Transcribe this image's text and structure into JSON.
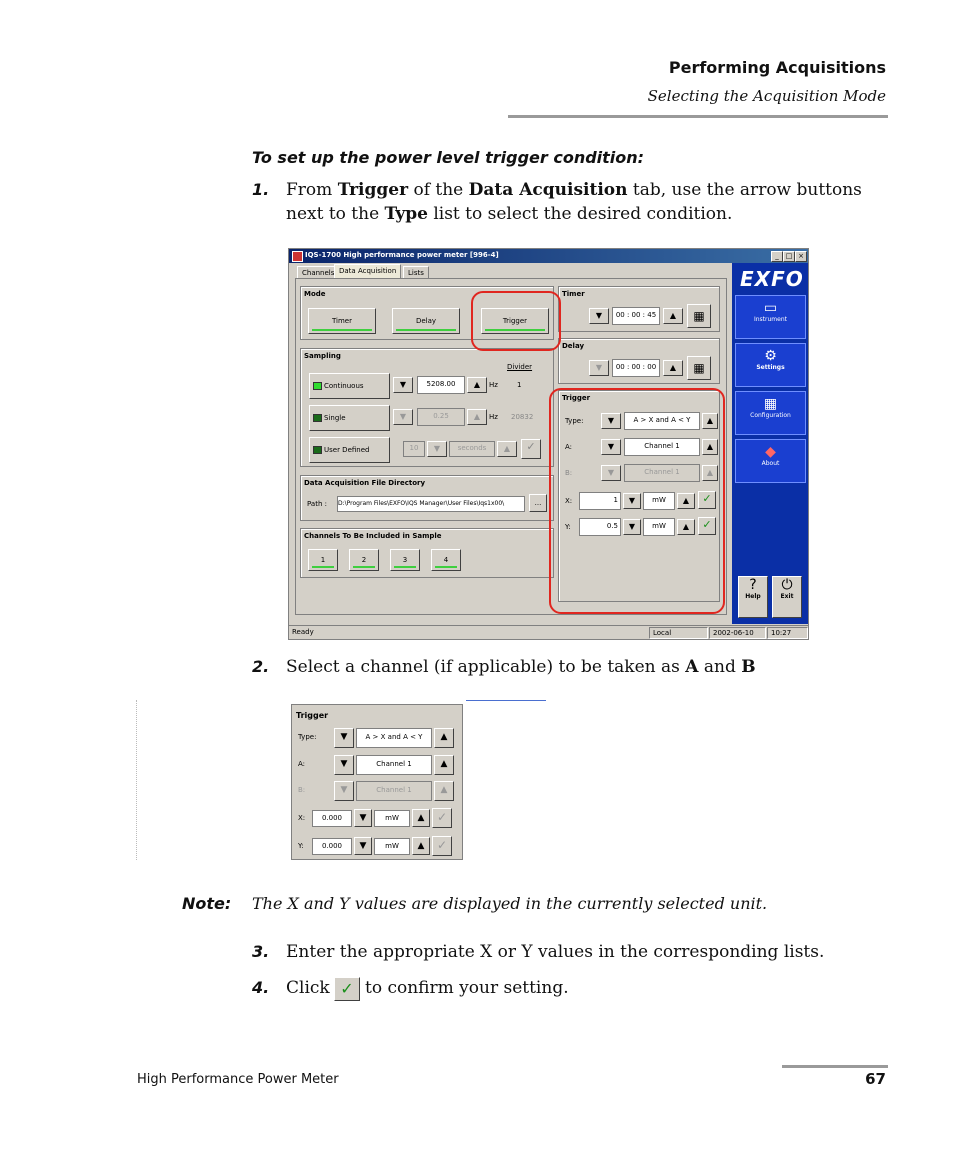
{
  "header": {
    "title": "Performing Acquisitions",
    "subtitle": "Selecting the Acquisition Mode"
  },
  "procedure_title": "To set up the power level trigger condition:",
  "steps": [
    {
      "num": "1.",
      "parts": [
        "From ",
        "Trigger",
        " of the ",
        "Data Acquisition",
        " tab, use the arrow buttons next to the ",
        "Type",
        " list to select the desired condition."
      ]
    },
    {
      "num": "2.",
      "parts": [
        "Select a channel (if applicable) to be taken as ",
        "A",
        " and ",
        "B"
      ]
    },
    {
      "num": "3.",
      "text": "Enter the appropriate X or Y values in the corresponding lists."
    },
    {
      "num": "4.",
      "pre": "Click",
      "post": "to confirm your setting."
    }
  ],
  "note": {
    "label": "Note:",
    "text": "The X and Y values are displayed in the currently selected unit."
  },
  "footer": {
    "left": "High Performance Power Meter",
    "page": "67"
  },
  "app": {
    "title": "IQS-1700 High performance power meter [996-4]",
    "tabs": [
      "Channels",
      "Data Acquisition",
      "Lists"
    ],
    "mode": {
      "title": "Mode",
      "buttons": [
        "Timer",
        "Delay",
        "Trigger"
      ]
    },
    "timer": {
      "title": "Timer",
      "value": "00 : 00 : 45"
    },
    "delay": {
      "title": "Delay",
      "value": "00 : 00 : 00"
    },
    "sampling": {
      "title": "Sampling",
      "divider_label": "Divider",
      "continuous": "Continuous",
      "cont_value": "5208.00",
      "cont_unit": "Hz",
      "cont_div": "1",
      "single": "Single",
      "single_value": "0.25",
      "single_unit": "Hz",
      "single_div": "20832",
      "user_defined": "User Defined",
      "ud_n": "10",
      "ud_unit": "seconds"
    },
    "directory": {
      "title": "Data Acquisition File Directory",
      "path_label": "Path :",
      "path": "D:\\Program Files\\EXFO\\IQS Manager\\User Files\\Iqs1x00\\",
      "browse": "..."
    },
    "channels": {
      "title": "Channels To Be Included in Sample",
      "items": [
        "1",
        "2",
        "3",
        "4"
      ]
    },
    "trigger": {
      "title": "Trigger",
      "type_label": "Type:",
      "type_value": "A > X and A < Y",
      "a_label": "A:",
      "a_value": "Channel 1",
      "b_label": "B:",
      "b_value": "Channel 1",
      "x_label": "X:",
      "x_value": "1",
      "x_unit": "mW",
      "y_label": "Y:",
      "y_value": "0.5",
      "y_unit": "mW"
    },
    "sidebar": {
      "logo": "EXFO",
      "items": [
        "Instrument",
        "Settings",
        "Configuration",
        "About"
      ],
      "help": "Help",
      "exit": "Exit"
    },
    "status": {
      "ready": "Ready",
      "local": "Local",
      "date": "2002-06-10",
      "time": "10:27"
    }
  },
  "zoom": {
    "title": "Trigger",
    "type_label": "Type:",
    "type_value": "A > X and A < Y",
    "a_label": "A:",
    "a_value": "Channel 1",
    "b_label": "B:",
    "b_value": "Channel 1",
    "x_label": "X:",
    "x_value": "0.000",
    "x_unit": "mW",
    "y_label": "Y:",
    "y_value": "0.000",
    "y_unit": "mW"
  }
}
